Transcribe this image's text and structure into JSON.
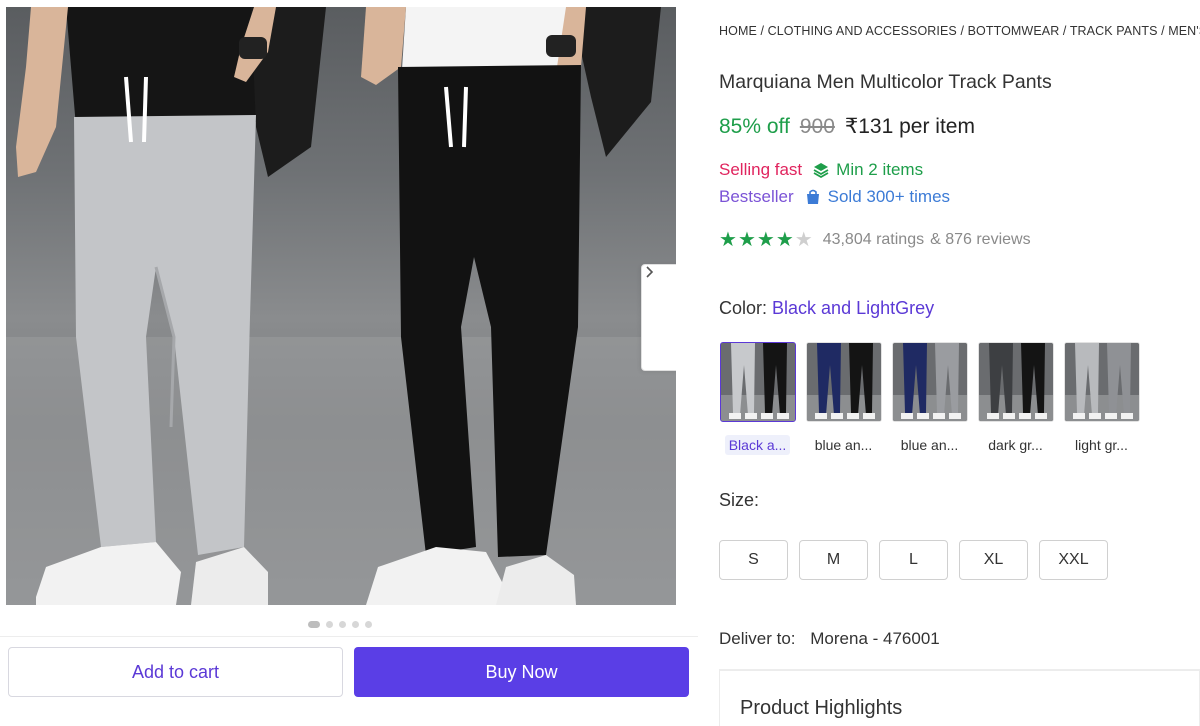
{
  "breadcrumb": "HOME / CLOTHING AND ACCESSORIES / BOTTOMWEAR / TRACK PANTS / MEN'S",
  "product": {
    "title": "Marquiana Men Multicolor Track Pants",
    "discount": "85% off",
    "mrp": "900",
    "price": "₹131 per item"
  },
  "badges": {
    "selling_fast": "Selling fast",
    "min_items": "Min 2 items",
    "bestseller": "Bestseller",
    "sold": "Sold 300+ times"
  },
  "rating": {
    "stars": 4,
    "max_stars": 5,
    "ratings": "43,804 ratings",
    "reviews": "& 876 reviews"
  },
  "color": {
    "label": "Color:",
    "selected": "Black and LightGrey",
    "options": [
      {
        "label": "Black a...",
        "pants": [
          "#c7c9cc",
          "#141414"
        ]
      },
      {
        "label": "blue an...",
        "pants": [
          "#1f2a63",
          "#141414"
        ]
      },
      {
        "label": "blue an...",
        "pants": [
          "#1f2a63",
          "#9a9ca0"
        ]
      },
      {
        "label": "dark gr...",
        "pants": [
          "#3d3f42",
          "#141414"
        ]
      },
      {
        "label": "light gr...",
        "pants": [
          "#b8babd",
          "#8f9195"
        ]
      }
    ]
  },
  "size": {
    "label": "Size:",
    "options": [
      "S",
      "M",
      "L",
      "XL",
      "XXL"
    ]
  },
  "delivery": {
    "label": "Deliver to:",
    "location": "Morena - 476001"
  },
  "highlights_title": "Product Highlights",
  "actions": {
    "add_to_cart": "Add to cart",
    "buy_now": "Buy Now"
  },
  "gallery": {
    "image_count": 5,
    "active_index": 0
  },
  "colors": {
    "accent": "#5a3ee6",
    "discount_green": "#1e9e4a",
    "selling_fast": "#e0245e"
  }
}
